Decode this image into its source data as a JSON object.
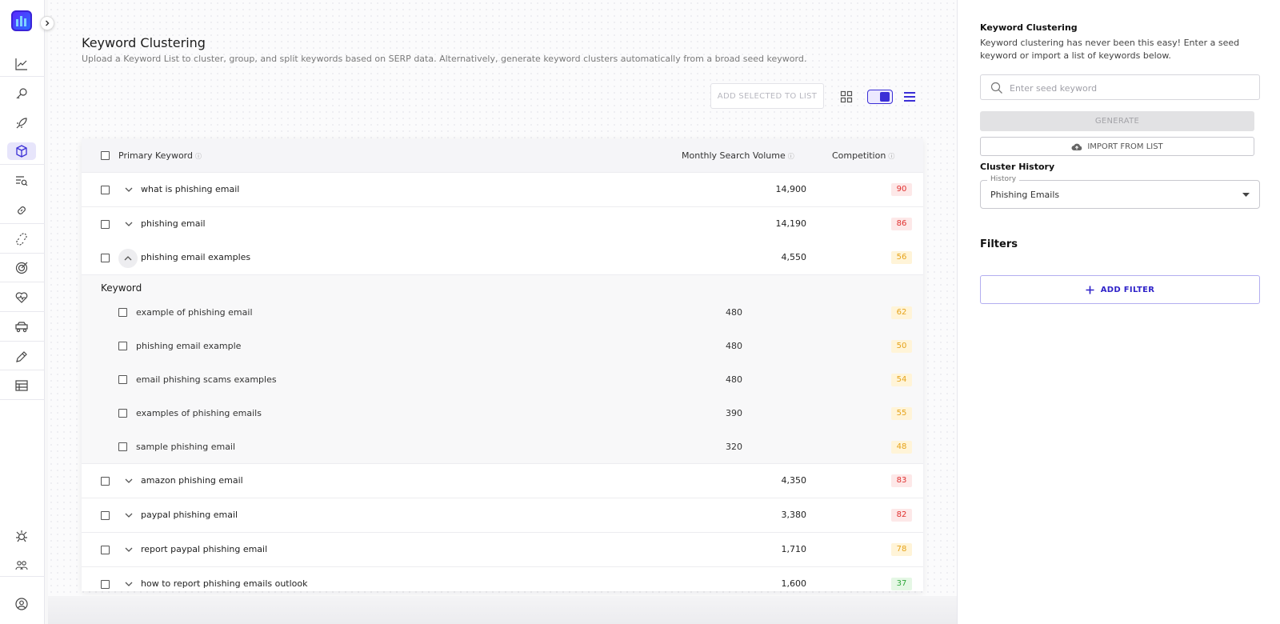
{
  "header": {
    "title": "Keyword Clustering",
    "subtitle": "Upload a Keyword List to cluster, group, and split keywords based on SERP data. Alternatively, generate keyword clusters automatically from a broad seed keyword."
  },
  "toolbar": {
    "add_selected_label": "ADD SELECTED TO LIST"
  },
  "table": {
    "columns": {
      "primary_keyword": "Primary Keyword",
      "monthly_search_volume": "Monthly Search Volume",
      "competition": "Competition"
    },
    "rows": [
      {
        "keyword": "what is phishing email",
        "volume": "14,900",
        "competition": "90",
        "level": "high"
      },
      {
        "keyword": "phishing email",
        "volume": "14,190",
        "competition": "86",
        "level": "high"
      },
      {
        "keyword": "phishing email examples",
        "volume": "4,550",
        "competition": "56",
        "level": "medium",
        "expanded": true
      },
      {
        "keyword": "amazon phishing email",
        "volume": "4,350",
        "competition": "83",
        "level": "high"
      },
      {
        "keyword": "paypal phishing email",
        "volume": "3,380",
        "competition": "82",
        "level": "high"
      },
      {
        "keyword": "report paypal phishing email",
        "volume": "1,710",
        "competition": "78",
        "level": "medium"
      },
      {
        "keyword": "how to report phishing emails outlook",
        "volume": "1,600",
        "competition": "37",
        "level": "low"
      }
    ],
    "expanded": {
      "title": "Keyword",
      "rows": [
        {
          "keyword": "example of phishing email",
          "volume": "480",
          "competition": "62"
        },
        {
          "keyword": "phishing email example",
          "volume": "480",
          "competition": "50"
        },
        {
          "keyword": "email phishing scams examples",
          "volume": "480",
          "competition": "54"
        },
        {
          "keyword": "examples of phishing emails",
          "volume": "390",
          "competition": "55"
        },
        {
          "keyword": "sample phishing email",
          "volume": "320",
          "competition": "48"
        }
      ]
    }
  },
  "right_panel": {
    "title": "Keyword Clustering",
    "description": "Keyword clustering has never been this easy! Enter a seed keyword or import a list of keywords below.",
    "seed_placeholder": "Enter seed keyword",
    "generate_label": "GENERATE",
    "import_label": "IMPORT FROM LIST",
    "cluster_history_title": "Cluster History",
    "history_label": "History",
    "history_value": "Phishing Emails",
    "filters_title": "Filters",
    "add_filter_label": "ADD FILTER"
  },
  "colors": {
    "accent": "#3b2fd6",
    "competition_high_bg": "#fde8e8",
    "competition_high_fg": "#e0302e",
    "competition_medium_bg": "#fff4d8",
    "competition_medium_fg": "#e6a31a",
    "competition_low_bg": "#e5f7e5",
    "competition_low_fg": "#2ea83a"
  },
  "sidebar": {
    "items": [
      {
        "icon": "chart-line-icon"
      },
      {
        "icon": "key-icon"
      },
      {
        "icon": "rocket-icon"
      },
      {
        "icon": "cube-icon",
        "active": true
      },
      {
        "icon": "list-search-icon"
      },
      {
        "icon": "link-icon"
      },
      {
        "icon": "broken-link-icon"
      },
      {
        "icon": "target-icon"
      },
      {
        "icon": "heartbeat-icon"
      },
      {
        "icon": "car-icon"
      },
      {
        "icon": "pen-icon"
      },
      {
        "icon": "table-icon"
      },
      {
        "icon": "bug-icon"
      },
      {
        "icon": "team-icon"
      },
      {
        "icon": "account-icon"
      }
    ]
  }
}
